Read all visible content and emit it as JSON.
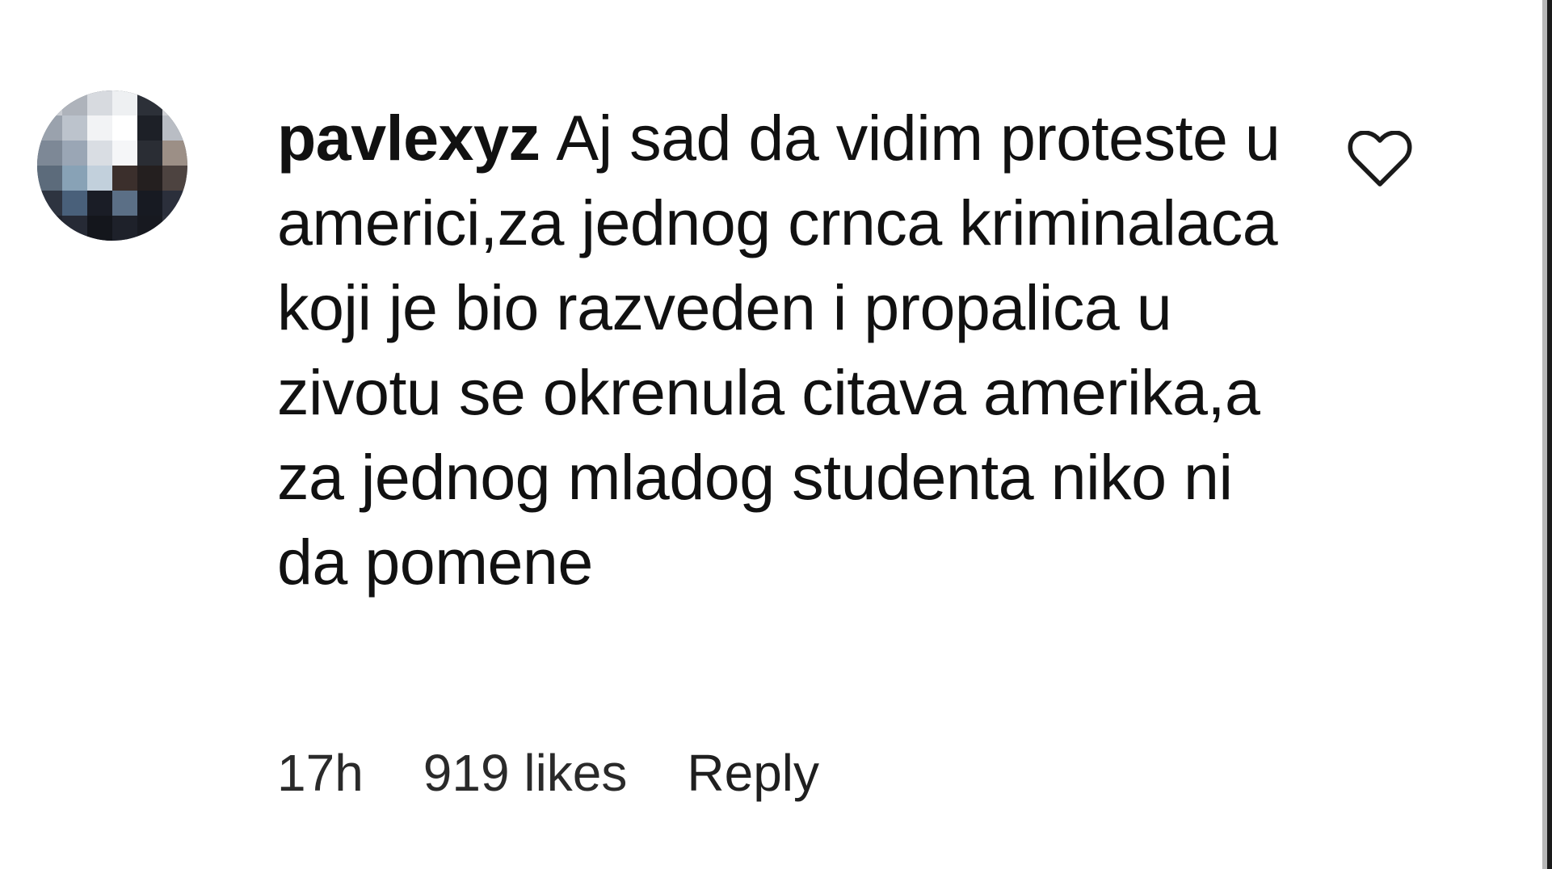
{
  "comment": {
    "username": "pavlexyz",
    "text": "Aj sad da vidim proteste u americi,za jednog crnca kriminalaca koji je bio razveden i propalica u zivotu se okrenula citava amerika,a za jednog mladog studenta niko ni da pomene",
    "time": "17h",
    "likes": "919 likes",
    "reply_label": "Reply"
  },
  "icons": {
    "like": "heart-icon",
    "avatar": "pixelated-avatar"
  },
  "colors": {
    "text": "#111111",
    "meta_text": "#2a2a2a",
    "background": "#ffffff"
  }
}
